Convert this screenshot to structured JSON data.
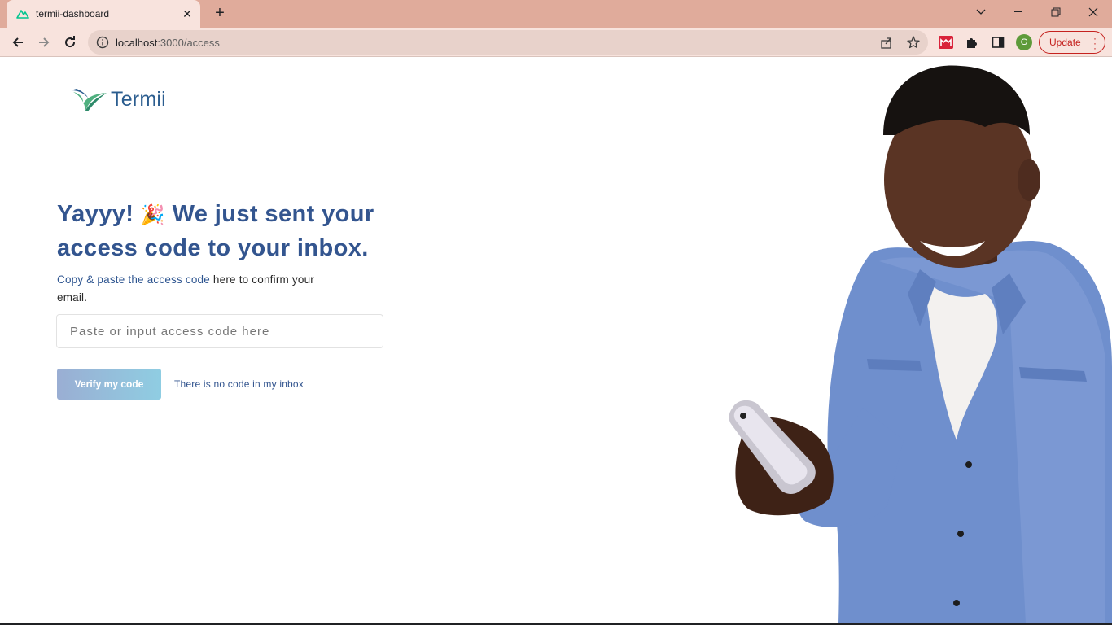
{
  "browser": {
    "tab_title": "termii-dashboard",
    "url_host": "localhost",
    "url_path": ":3000/access",
    "avatar_letter": "G",
    "update_label": "Update",
    "accent_color": "#e0ab9b"
  },
  "brand": {
    "name": "Termii"
  },
  "content": {
    "headline_part1": "Yayyy!",
    "headline_emoji": "🎉",
    "headline_part2": "We just sent your access code to your inbox.",
    "sub_highlight": "Copy & paste the access code",
    "sub_rest": " here to confirm your email.",
    "input_placeholder": "Paste or input access code here",
    "verify_label": "Verify my code",
    "no_code_label": "There is no code in my inbox"
  }
}
